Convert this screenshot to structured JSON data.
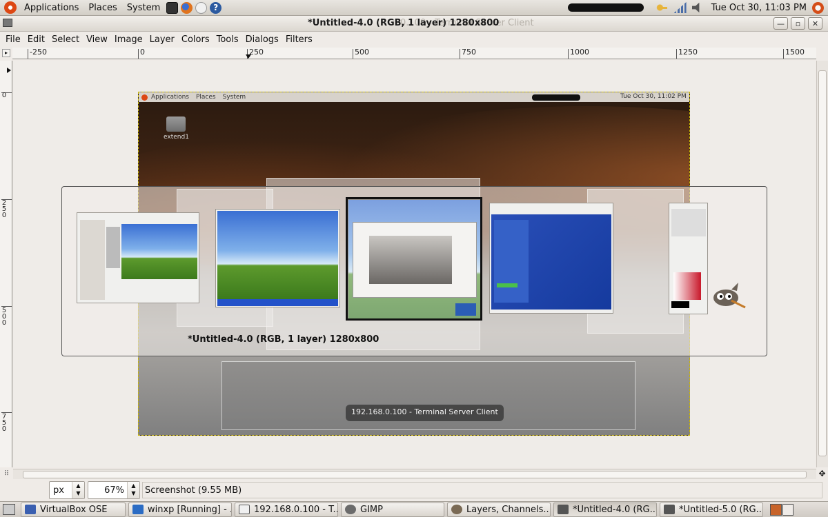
{
  "top_panel": {
    "menus": [
      "Applications",
      "Places",
      "System"
    ],
    "clock": "Tue Oct 30, 11:03 PM"
  },
  "window": {
    "title": "*Untitled-4.0 (RGB, 1 layer) 1280x800",
    "background_title_fragment": "0.100 - Terminal Server Client"
  },
  "menubar": [
    "File",
    "Edit",
    "Select",
    "View",
    "Image",
    "Layer",
    "Colors",
    "Tools",
    "Dialogs",
    "Filters"
  ],
  "hruler": [
    "-250",
    "0",
    "250",
    "500",
    "750",
    "1000",
    "1250",
    "1500"
  ],
  "vruler": [
    [
      "0"
    ],
    [
      "2",
      "5",
      "0"
    ],
    [
      "5",
      "0",
      "0"
    ],
    [
      "7",
      "5",
      "0"
    ]
  ],
  "image": {
    "inner_menus": [
      "Applications",
      "Places",
      "System"
    ],
    "inner_clock": "Tue Oct 30, 11:02 PM",
    "desktop_icon_label": "extend1",
    "tooltip": "192.168.0.100 - Terminal Server Client"
  },
  "switcher": {
    "caption": "*Untitled-4.0 (RGB, 1 layer) 1280x800"
  },
  "statusbar": {
    "unit": "px",
    "zoom": "67%",
    "message": "Screenshot (9.55 MB)"
  },
  "taskbar": [
    {
      "label": "VirtualBox OSE",
      "color": "#3a5fb0"
    },
    {
      "label": "winxp [Running] - ...",
      "color": "#2b6cc4"
    },
    {
      "label": "192.168.0.100 - T...",
      "color": "#e0e0e0"
    },
    {
      "label": "GIMP",
      "color": "#6b6b6b"
    },
    {
      "label": "Layers, Channels...",
      "color": "#7a6a55"
    },
    {
      "label": "*Untitled-4.0 (RG...",
      "color": "#555555"
    },
    {
      "label": "*Untitled-5.0 (RG...",
      "color": "#555555"
    }
  ],
  "colors": {
    "accent": "#dd4814",
    "canvas_bg": "#efece8"
  }
}
